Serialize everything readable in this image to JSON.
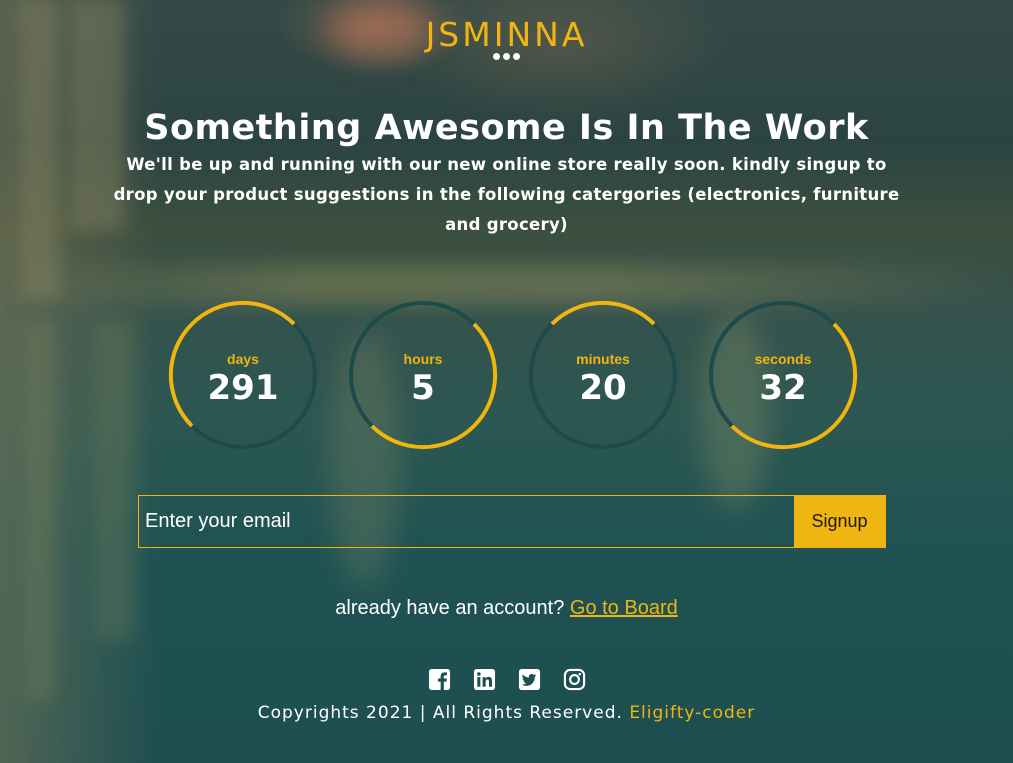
{
  "brand": {
    "name": "JSMINNA"
  },
  "hero": {
    "headline": "Something Awesome Is In The Work",
    "subtext": "We'll be up and running with our new online store really soon. kindly singup to drop your product suggestions in the following catergories (electronics, furniture and grocery)"
  },
  "countdown": [
    {
      "unit": "days",
      "value": "291"
    },
    {
      "unit": "hours",
      "value": "5"
    },
    {
      "unit": "minutes",
      "value": "20"
    },
    {
      "unit": "seconds",
      "value": "32"
    }
  ],
  "signup_form": {
    "email_placeholder": "Enter your email",
    "email_value": "",
    "button_label": "Signup"
  },
  "account": {
    "prompt": "already have an account?",
    "link_label": "Go to Board"
  },
  "social_icons": [
    "facebook-icon",
    "linkedin-icon",
    "twitter-icon",
    "instagram-icon"
  ],
  "footer": {
    "copyright": "Copyrights 2021 | All Rights Reserved.",
    "author": "Eligifty-coder"
  },
  "colors": {
    "accent": "#f0b510",
    "ring_track": "#1d4a4a",
    "text": "#ffffff",
    "background": "#1f4e50"
  }
}
